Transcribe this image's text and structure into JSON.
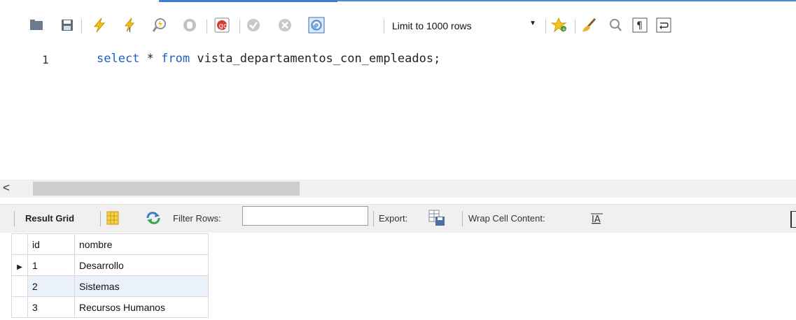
{
  "toolbar": {
    "limit_label": "Limit to 1000 rows",
    "icons": [
      "open-folder-icon",
      "save-icon",
      "execute-icon",
      "execute-current-icon",
      "explain-icon",
      "stop-icon",
      "toggle-error-icon",
      "commit-icon",
      "rollback-icon",
      "autocommit-icon",
      "add-snippet-icon",
      "beautify-icon",
      "find-icon",
      "invisible-chars-icon",
      "word-wrap-icon"
    ]
  },
  "editor": {
    "line_number": "1",
    "query_keyword1": "select",
    "query_part2": " * ",
    "query_keyword2": "from",
    "query_rest": " vista_departamentos_con_empleados;"
  },
  "result_bar": {
    "result_grid": "Result Grid",
    "filter_rows": "Filter Rows:",
    "filter_value": "",
    "export": "Export:",
    "wrap_cell": "Wrap Cell Content:"
  },
  "grid": {
    "columns": [
      "id",
      "nombre"
    ],
    "rows": [
      {
        "id": "1",
        "nombre": "Desarrollo"
      },
      {
        "id": "2",
        "nombre": "Sistemas"
      },
      {
        "id": "3",
        "nombre": "Recursos Humanos"
      }
    ]
  },
  "colors": {
    "keyword": "#1f5fbf",
    "accent": "#3c7fd0",
    "selected_row": "#eaf1fb"
  }
}
